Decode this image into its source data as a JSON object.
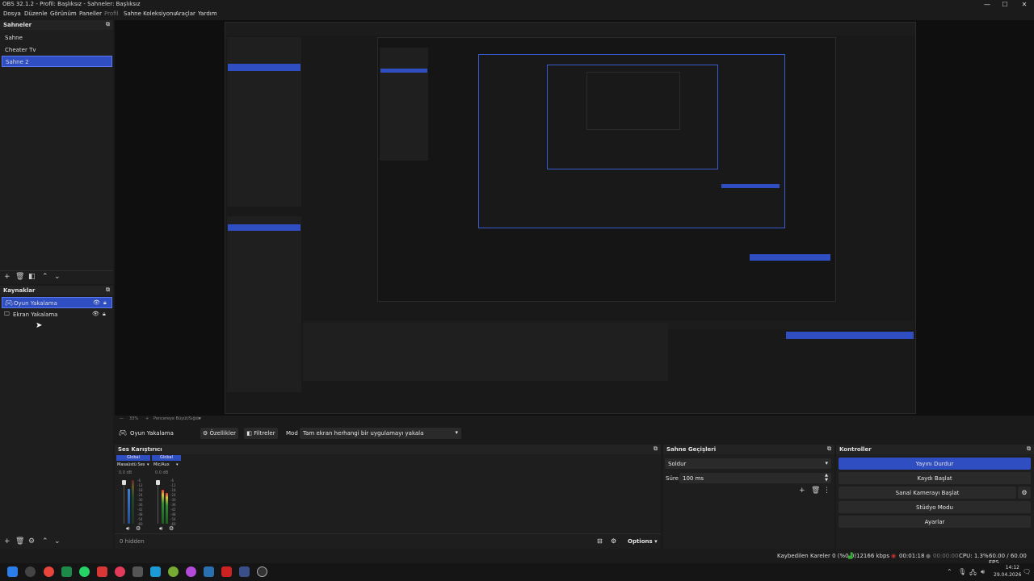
{
  "window": {
    "title": "OBS 32.1.2 - Profil: Başlıksız - Sahneler: Başlıksız",
    "minimize": "—",
    "maximize": "☐",
    "close": "✕"
  },
  "menu": [
    "Dosya",
    "Düzenle",
    "Görünüm",
    "Paneller",
    "Profil",
    "Sahne Koleksiyonu",
    "Araçlar",
    "Yardım"
  ],
  "scenes": {
    "title": "Sahneler",
    "items": [
      "Sahne",
      "Cheater Tv",
      "Sahne 2"
    ],
    "selected_index": 2
  },
  "sources": {
    "title": "Kaynaklar",
    "items": [
      "Oyun Yakalama",
      "Ekran Yakalama"
    ],
    "selected_index": 0
  },
  "source_toolbar": {
    "name": "Oyun Yakalama",
    "properties": "Özellikler",
    "filters": "Filtreler",
    "mode_label": "Mod",
    "mode_value": "Tam ekran herhangi bir uygulamayı yakala"
  },
  "zoom_bar": {
    "zoom": "33%",
    "fit": "Pencereye Büyüt/Sığdır"
  },
  "mixer": {
    "title": "Ses Karıştırıcı",
    "channels": [
      {
        "group": "Global",
        "name": "Masaüstü Ses",
        "level": "0.0 dB"
      },
      {
        "group": "Global",
        "name": "Mic/Aux",
        "level": "0.0 dB"
      }
    ],
    "ticks": [
      "-6",
      "-12",
      "-18",
      "-24",
      "-30",
      "-36",
      "-42",
      "-48",
      "-54",
      "-60"
    ],
    "hidden": "0 hidden",
    "options": "Options"
  },
  "transitions": {
    "title": "Sahne Geçişleri",
    "type": "Soldur",
    "duration_label": "Süre",
    "duration_value": "100 ms"
  },
  "controls": {
    "title": "Kontroller",
    "buttons": [
      "Yayını Durdur",
      "Kaydı Başlat",
      "Sanal Kamerayı Başlat",
      "Stüdyo Modu",
      "Ayarlar"
    ]
  },
  "status": {
    "dropped": "Kaybedilen Kareler 0 (%0.0)",
    "bitrate": "12166 kbps",
    "stream_time": "00:01:18",
    "rec_time": "00:00:00",
    "cpu": "CPU: 1.3%",
    "fps": "60.00 / 60.00 FPS"
  },
  "tray": {
    "time": "14:12",
    "date": "29.04.2026"
  },
  "colors": {
    "accent": "#2f4ec2",
    "panel": "#1e1e1e",
    "background": "#1a1a1a"
  }
}
